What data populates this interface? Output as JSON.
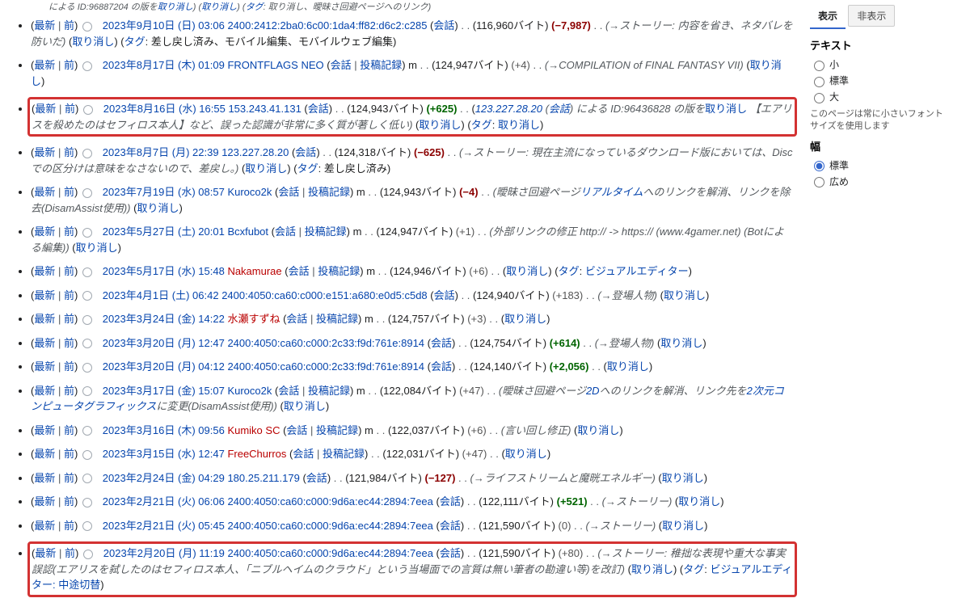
{
  "strings": {
    "cur": "最新",
    "prev": "前",
    "talk": "会話",
    "contribs": "投稿記録",
    "undo": "取り消し",
    "tag": "タグ",
    "revert": "差し戻し済み",
    "mobile1": "モバイル編集",
    "mobile2": "モバイルウェブ編集",
    "ve": "ビジュアルエディター",
    "veswitch": "ビジュアルエディター: 中途切替",
    "by": " による ",
    "revof": " の版を",
    "cancel": "取り消し"
  },
  "topfrag": {
    "pre": "による ID:96887204 の版を",
    "undo1": "取り消し",
    "paren": ") (",
    "undo2": "取り消し",
    "paren2": ") (",
    "tag": "タグ",
    "sep": ": 取り消し、曖昧さ回避ページへのリンク)"
  },
  "rows": [
    {
      "hl": false,
      "date": "2023年9月10日 (日) 03:06",
      "user": "2400:2412:2ba0:6c00:1da4:ff82:d6c2:c285",
      "talkonly": true,
      "userred": false,
      "bytes": "116,960バイト",
      "diff": "(−7,987)",
      "diffcls": "redchg",
      "m": false,
      "summary": "(→ストーリー: 内容を省き、ネタバレを防いだ)",
      "undo": true,
      "tags": [
        "差し戻し済み",
        "モバイル編集",
        "モバイルウェブ編集"
      ]
    },
    {
      "hl": false,
      "date": "2023年8月17日 (木) 01:09",
      "user": "FRONTFLAGS NEO",
      "talkonly": false,
      "userred": false,
      "bytes": "124,947バイト",
      "diff": "(+4)",
      "diffcls": "greychg",
      "m": true,
      "summary": "(→COMPILATION of FINAL FANTASY VII)",
      "undo": true,
      "tags": []
    },
    {
      "hl": true,
      "date": "2023年8月16日 (水) 16:55",
      "user": "153.243.41.131",
      "talkonly": true,
      "userred": false,
      "bytes": "124,943バイト",
      "diff": "(+625)",
      "diffcls": "green",
      "m": false,
      "summarycustom": true,
      "undo": true,
      "tags": [
        "取り消し"
      ]
    },
    {
      "hl": false,
      "date": "2023年8月7日 (月) 22:39",
      "user": "123.227.28.20",
      "talkonly": true,
      "userred": false,
      "bytes": "124,318バイト",
      "diff": "(−625)",
      "diffcls": "redchg",
      "m": false,
      "summary": "(→ストーリー: 現在主流になっているダウンロード版においては、Discでの区分けは意味をなさないので、差戻し。)",
      "undo": true,
      "tags": [
        "差し戻し済み"
      ]
    },
    {
      "hl": false,
      "date": "2023年7月19日 (水) 08:57",
      "user": "Kuroco2k",
      "talkonly": false,
      "userred": false,
      "bytes": "124,943バイト",
      "diff": "(−4)",
      "diffcls": "redchg",
      "m": true,
      "summary": "(曖昧さ回避ページリアルタイムへのリンクを解消、リンクを除去(DisamAssist使用))",
      "summarylinks": [
        "リアルタイム"
      ],
      "undo": true,
      "tags": []
    },
    {
      "hl": false,
      "date": "2023年5月27日 (土) 20:01",
      "user": "Bcxfubot",
      "talkonly": false,
      "userred": false,
      "bytes": "124,947バイト",
      "diff": "(+1)",
      "diffcls": "greychg",
      "m": true,
      "summary": "(外部リンクの修正 http:// -> https:// (www.4gamer.net) (Botによる編集))",
      "undo": true,
      "tags": []
    },
    {
      "hl": false,
      "date": "2023年5月17日 (水) 15:48",
      "user": "Nakamurae",
      "talkonly": false,
      "userred": true,
      "bytes": "124,946バイト",
      "diff": "(+6)",
      "diffcls": "greychg",
      "m": true,
      "summary": "",
      "undo": true,
      "tags": [
        "ビジュアルエディター"
      ]
    },
    {
      "hl": false,
      "date": "2023年4月1日 (土) 06:42",
      "user": "2400:4050:ca60:c000:e151:a680:e0d5:c5d8",
      "talkonly": true,
      "userred": false,
      "bytes": "124,940バイト",
      "diff": "(+183)",
      "diffcls": "greychg",
      "m": false,
      "summary": "(→登場人物)",
      "undo": true,
      "tags": []
    },
    {
      "hl": false,
      "date": "2023年3月24日 (金) 14:22",
      "user": "水瀬すずね",
      "talkonly": false,
      "userred": true,
      "bytes": "124,757バイト",
      "diff": "(+3)",
      "diffcls": "greychg",
      "m": true,
      "summary": "",
      "undo": true,
      "tags": []
    },
    {
      "hl": false,
      "date": "2023年3月20日 (月) 12:47",
      "user": "2400:4050:ca60:c000:2c33:f9d:761e:8914",
      "talkonly": true,
      "userred": false,
      "bytes": "124,754バイト",
      "diff": "(+614)",
      "diffcls": "green",
      "m": false,
      "summary": "(→登場人物)",
      "undo": true,
      "tags": []
    },
    {
      "hl": false,
      "date": "2023年3月20日 (月) 04:12",
      "user": "2400:4050:ca60:c000:2c33:f9d:761e:8914",
      "talkonly": true,
      "userred": false,
      "bytes": "124,140バイト",
      "diff": "(+2,056)",
      "diffcls": "green",
      "m": false,
      "summary": "",
      "undo": true,
      "tags": []
    },
    {
      "hl": false,
      "date": "2023年3月17日 (金) 15:07",
      "user": "Kuroco2k",
      "talkonly": false,
      "userred": false,
      "bytes": "122,084バイト",
      "diff": "(+47)",
      "diffcls": "greychg",
      "m": true,
      "summary": "(曖昧さ回避ページ2Dへのリンクを解消、リンク先を2次元コンピュータグラフィックスに変更(DisamAssist使用))",
      "summarylinks": [
        "2D",
        "2次元コンピュータグラフィックス"
      ],
      "undo": true,
      "tags": []
    },
    {
      "hl": false,
      "date": "2023年3月16日 (木) 09:56",
      "user": "Kumiko SC",
      "talkonly": false,
      "userred": true,
      "bytes": "122,037バイト",
      "diff": "(+6)",
      "diffcls": "greychg",
      "m": true,
      "summary": "(言い回し修正)",
      "undo": true,
      "tags": []
    },
    {
      "hl": false,
      "date": "2023年3月15日 (水) 12:47",
      "user": "FreeChurros",
      "talkonly": false,
      "userred": true,
      "bytes": "122,031バイト",
      "diff": "(+47)",
      "diffcls": "greychg",
      "m": false,
      "summary": "",
      "undo": true,
      "tags": []
    },
    {
      "hl": false,
      "date": "2023年2月24日 (金) 04:29",
      "user": "180.25.211.179",
      "talkonly": true,
      "userred": false,
      "bytes": "121,984バイト",
      "diff": "(−127)",
      "diffcls": "redchg",
      "m": false,
      "summary": "(→ライフストリームと魔晄エネルギー)",
      "undo": true,
      "tags": []
    },
    {
      "hl": false,
      "date": "2023年2月21日 (火) 06:06",
      "user": "2400:4050:ca60:c000:9d6a:ec44:2894:7eea",
      "talkonly": true,
      "userred": false,
      "bytes": "122,111バイト",
      "diff": "(+521)",
      "diffcls": "green",
      "m": false,
      "summary": "(→ストーリー)",
      "undo": true,
      "tags": []
    },
    {
      "hl": false,
      "date": "2023年2月21日 (火) 05:45",
      "user": "2400:4050:ca60:c000:9d6a:ec44:2894:7eea",
      "talkonly": true,
      "userred": false,
      "bytes": "121,590バイト",
      "diff": "(0)",
      "diffcls": "greychg",
      "m": false,
      "summary": "(→ストーリー)",
      "undo": true,
      "tags": []
    },
    {
      "hl": true,
      "date": "2023年2月20日 (月) 11:19",
      "user": "2400:4050:ca60:c000:9d6a:ec44:2894:7eea",
      "talkonly": true,
      "userred": false,
      "bytes": "121,590バイト",
      "diff": "(+80)",
      "diffcls": "greychg",
      "m": false,
      "summary": "(→ストーリー: 稚拙な表現や重大な事実誤認(エアリスを弑したのはセフィロス本人、「ニブルヘイムのクラウド」という当場面での言質は無い筆者の勘違い等)を改訂)",
      "undo": true,
      "tags": [
        "ビジュアルエディター: 中途切替"
      ]
    }
  ],
  "hlrow": {
    "prevuser": "123.227.28.20",
    "prevtalk": "会話",
    "revid": "ID:96436828",
    "extra": "【エアリスを殺めたのはセフィロス本人】など、誤った認識が非常に多く質が著しく低い)"
  },
  "side": {
    "displayTab": "表示",
    "hideTab": "非表示",
    "textHdr": "テキスト",
    "small": "小",
    "normal": "標準",
    "large": "大",
    "note": "このページは常に小さいフォントサイズを使用します",
    "widthHdr": "幅",
    "wnormal": "標準",
    "wwide": "広め"
  }
}
